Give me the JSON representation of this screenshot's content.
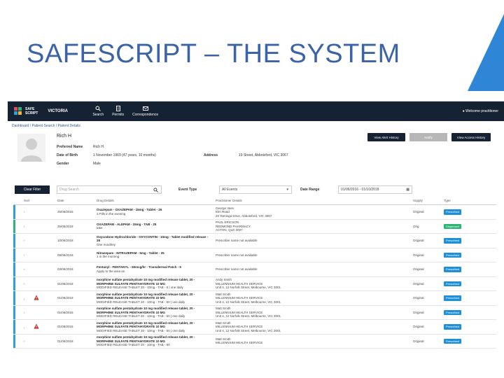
{
  "slide": {
    "title": "SAFESCRIPT – THE SYSTEM"
  },
  "nav": {
    "logo_line1": "SAFE",
    "logo_line2": "SCRIPT",
    "gov_logo": "VICTORIA",
    "items": [
      {
        "label": "Search",
        "icon": "search-icon"
      },
      {
        "label": "Permits",
        "icon": "document-icon"
      },
      {
        "label": "Correspondence",
        "icon": "mail-icon"
      }
    ],
    "welcome": "Welcome practitioner"
  },
  "breadcrumb": "Dashboard / Patient Search / Patient Details",
  "patient": {
    "name": "Rich H",
    "labels": {
      "preferred": "Preferred Name",
      "dob": "Date of Birth",
      "gender": "Gender",
      "address": "Address"
    },
    "preferred": "Rich H",
    "dob": "1 November 1969 (47 years, 10 months)",
    "gender": "Male",
    "address": "19 Street, Abbotsford, VIC 3067",
    "buttons": [
      {
        "label": "View Alert History",
        "color": "#142233"
      },
      {
        "label": "Notify",
        "color": "#b7b7b7"
      },
      {
        "label": "View Access History",
        "color": "#142233"
      }
    ]
  },
  "filters": {
    "clear_label": "Clear Filter",
    "search_placeholder": "Drug Search",
    "event_type_label": "Event Type",
    "event_type_value": "All Events",
    "date_range_label": "Date Range",
    "date_range_value": "01/06/2016 - 01/10/2018"
  },
  "table": {
    "headers": [
      "",
      "Sort",
      "Date",
      "Drug Details",
      "Practitioner Details",
      "",
      "Supply",
      "Type"
    ],
    "rows": [
      {
        "bar": "#2f9fd8",
        "warn": false,
        "date": "25/06/2018",
        "drug": "Oxazepam - OXAZEPAM - 15mg - Tablet - 25",
        "drug2": "2 Pills in the evening",
        "prac": "George Vass",
        "prac2": "Elm Road",
        "prac3": "20 Taminga Drive, Abbotsford, VIC 3067",
        "supply": "Original",
        "type": "Prescribed",
        "type_color": "#1f8fd6"
      },
      {
        "bar": "#2bb673",
        "warn": false,
        "date": "25/06/2018",
        "drug": "OXAZEPAM - ALEPAM - 15mg - TAB - 25",
        "drug2": "take",
        "prac": "PAUL ERICSON",
        "prac2": "REDMOND PHARMACY",
        "prac3": "ACTON, QLD 0007",
        "supply": "Orig",
        "type": "Dispensed",
        "type_color": "#2bb673"
      },
      {
        "bar": "#2f9fd8",
        "warn": false,
        "date": "10/06/2018",
        "drug": "Oxycodone Hydrochloride - OXYCONTIN - 10mg - Tablet modified release - 28",
        "drug2": "One mouthey",
        "prac": "Prescriber name not available",
        "prac2": "",
        "prac3": "",
        "supply": "Original",
        "type": "Prescribed",
        "type_color": "#1f8fd6"
      },
      {
        "bar": "#2f9fd8",
        "warn": false,
        "date": "09/06/2018",
        "drug": "Nitrazepam - NITRAZEPAM - 5mg - Tablet - 25",
        "drug2": "1 in the morning",
        "prac": "Prescriber name not available",
        "prac2": "",
        "prac3": "",
        "supply": "Original",
        "type": "Prescribed",
        "type_color": "#1f8fd6"
      },
      {
        "bar": "#2f9fd8",
        "warn": false,
        "date": "03/06/2018",
        "drug": "Fentanyl - FENTANYL - 50mcg/hr - Transdermal Patch - 5",
        "drug2": "Apply to the area as",
        "prac": "Prescriber name not available",
        "prac2": "",
        "prac3": "",
        "supply": "Original",
        "type": "Prescribed",
        "type_color": "#1f8fd6"
      },
      {
        "bar": "#2f9fd8",
        "warn": false,
        "date": "01/06/2018",
        "drug": "morphine sulfate pentahydrate 10 mg modified release tablet, 20 - MORPHINE SULFATE PENTAHYDRATE 10 MG",
        "drug2": "MODIFIED RELEASE TABLET 20 - 10mg - TAB - 5 | one daily",
        "prac": "Andy Smith",
        "prac2": "MILLENNIUM HEALTH SERVICE",
        "prac3": "Unit 4, 12 Norfolk Street, Melbourne, VIC 3001",
        "supply": "Original",
        "type": "Prescribed",
        "type_color": "#1f8fd6"
      },
      {
        "bar": "#2f9fd8",
        "warn": true,
        "date": "01/06/2018",
        "drug": "morphine sulfate pentahydrate 10 mg modified release tablet, 20 - MORPHINE SULFATE PENTAHYDRATE 10 MG",
        "drug2": "MODIFIED RELEASE TABLET 20 - 10mg - TAB - 50 | one daily",
        "prac": "Matt Smith",
        "prac2": "MILLENNIUM HEALTH SERVICE",
        "prac3": "Unit 4, 12 Norfolk Street, Melbourne, VIC 3001",
        "supply": "Original",
        "type": "Prescribed",
        "type_color": "#1f8fd6"
      },
      {
        "bar": "#2f9fd8",
        "warn": false,
        "date": "01/06/2018",
        "drug": "morphine sulfate pentahydrate 10 mg modified release tablet, 20 - MORPHINE SULFATE PENTAHYDRATE 10 MG",
        "drug2": "MODIFIED RELEASE TABLET 20 - 10mg - TAB - 50 | one daily",
        "prac": "Matt Smith",
        "prac2": "MILLENNIUM HEALTH SERVICE",
        "prac3": "Unit 4, 12 Norfolk Street, Melbourne, VIC 3001",
        "supply": "Original",
        "type": "Prescribed",
        "type_color": "#1f8fd6"
      },
      {
        "bar": "#2f9fd8",
        "warn": true,
        "date": "01/06/2018",
        "drug": "morphine sulfate pentahydrate 10 mg modified release tablet, 20 - MORPHINE SULFATE PENTAHYDRATE 10 MG",
        "drug2": "MODIFIED RELEASE TABLET 20 - 10mg - TAB - 50 | one daily",
        "prac": "Matt Smith",
        "prac2": "MILLENNIUM HEALTH SERVICE",
        "prac3": "Unit 4, 12 Norfolk Street, Melbourne, VIC 3001",
        "supply": "Original",
        "type": "Prescribed",
        "type_color": "#1f8fd6"
      },
      {
        "bar": "#2f9fd8",
        "warn": false,
        "date": "01/06/2018",
        "drug": "morphine sulfate pentahydrate 10 mg modified release tablet, 20 - MORPHINE SULFATE PENTAHYDRATE 10 MG",
        "drug2": "MODIFIED RELEASE TABLET 20 - 10mg - TAB - 50",
        "prac": "Matt Smith",
        "prac2": "MILLENNIUM HEALTH SERVICE",
        "prac3": "",
        "supply": "Original",
        "type": "Prescribed",
        "type_color": "#1f8fd6"
      }
    ]
  }
}
